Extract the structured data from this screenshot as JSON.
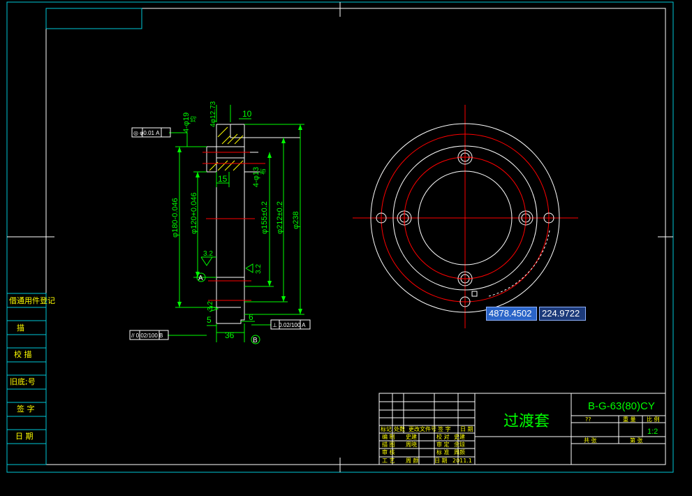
{
  "side_stamp": {
    "rows": [
      "借通用件登记",
      "描",
      "校 描",
      "旧底;号",
      "签 字",
      "日 期"
    ]
  },
  "dimensions": {
    "holes_top": "4-φ19",
    "holes_top_cb": "4φ12.73",
    "depth_10": "10",
    "holes_mid": "4-φ13",
    "note_bu": "布",
    "note_jun": "均",
    "dim_15": "15",
    "dia_180": "φ180-0.046",
    "dia_120": "φ120+0.046",
    "dia_155": "φ155±0.2",
    "dia_212": "φ212±0.2",
    "dia_238": "φ238",
    "rough_32_a": "3.2",
    "rough_32_b": "3.2",
    "rough_32_c": "3.2",
    "datum_a": "A",
    "datum_b": "B",
    "dim_5": "5",
    "dim_6": "6",
    "dim_36": "36",
    "tol_coax": "◎ φ0.01 A",
    "tol_perp": "⊥ 0.02/100 A",
    "tol_par": "// 0.02/100 B"
  },
  "title_block": {
    "part_name": "过渡套",
    "drawing_no": "B-G-63(80)CY",
    "scale": "1:2",
    "sheet_label": "共 张",
    "page_label": "第 张",
    "stage_label": "??",
    "weight_label": "重 量",
    "ratio_label": "比 例",
    "designer_label": "设计",
    "date_value": "2011.1",
    "rows": [
      [
        "标记",
        "处数",
        "更改文件号",
        "签 字",
        "日 期"
      ],
      [
        "编 制",
        "史建",
        "校 对",
        "史建"
      ],
      [
        "描 图",
        "周晓",
        "审 定",
        "余琼"
      ],
      [
        "审 核",
        "",
        "标 准",
        "周颜"
      ],
      [
        "工 艺",
        "周 颜",
        "日 期",
        "2011.1"
      ]
    ]
  },
  "coordinate_input": {
    "x": "4878.4502",
    "y": "224.9722"
  },
  "colors": {
    "background": "#000000",
    "frame": "#ffffff",
    "cyan": "#00c8d8",
    "green": "#00ff00",
    "red": "#ff0000",
    "yellow": "#ffff00"
  }
}
